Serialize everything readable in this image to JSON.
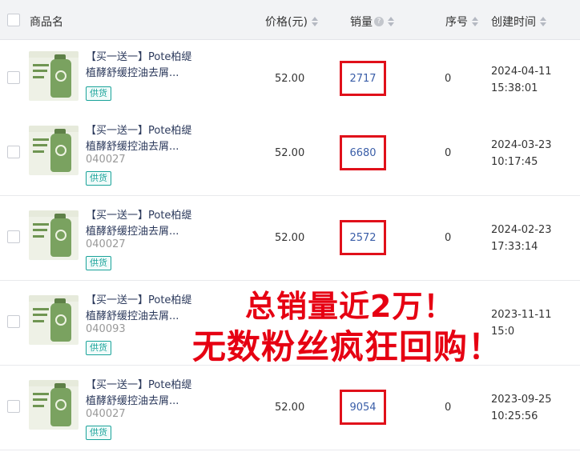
{
  "header": {
    "product_name": "商品名",
    "price": "价格(元)",
    "sales": "销量",
    "sequence": "序号",
    "created_time": "创建时间"
  },
  "rows": [
    {
      "title_line1": "【买一送一】Pote柏缇",
      "title_line2": "植酵舒缓控油去屑...",
      "code": "",
      "tag": "供货",
      "price": "52.00",
      "sales": "2717",
      "sales_highlighted": true,
      "sequence": "0",
      "date": "2024-04-11",
      "time": "15:38:01"
    },
    {
      "title_line1": "【买一送一】Pote柏缇",
      "title_line2": "植酵舒缓控油去屑...",
      "code": "040027",
      "tag": "供货",
      "price": "52.00",
      "sales": "6680",
      "sales_highlighted": true,
      "sequence": "0",
      "date": "2024-03-23",
      "time": "10:17:45"
    },
    {
      "title_line1": "【买一送一】Pote柏缇",
      "title_line2": "植酵舒缓控油去屑...",
      "code": "040027",
      "tag": "供货",
      "price": "52.00",
      "sales": "2572",
      "sales_highlighted": true,
      "sequence": "0",
      "date": "2024-02-23",
      "time": "17:33:14"
    },
    {
      "title_line1": "【买一送一】Pote柏缇",
      "title_line2": "植酵舒缓控油去屑...",
      "code": "040093",
      "tag": "供货",
      "price": "",
      "sales": "",
      "sales_highlighted": false,
      "sequence": "",
      "date": "2023-11-11",
      "time": "15:0"
    },
    {
      "title_line1": "【买一送一】Pote柏缇",
      "title_line2": "植酵舒缓控油去屑...",
      "code": "040027",
      "tag": "供货",
      "price": "52.00",
      "sales": "9054",
      "sales_highlighted": true,
      "sequence": "0",
      "date": "2023-09-25",
      "time": "10:25:56"
    }
  ],
  "overlay": {
    "line1": "总销量近2万！",
    "line2": "无数粉丝疯狂回购！",
    "color": "#e60012"
  },
  "colors": {
    "highlight_box": "#e0101a",
    "tag": "#1aa39a",
    "link_number": "#3a5ea8"
  }
}
